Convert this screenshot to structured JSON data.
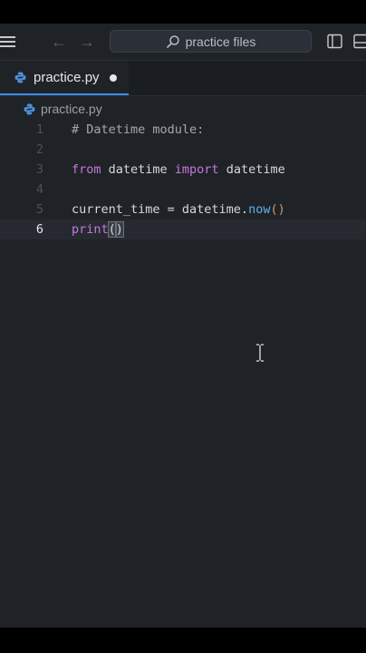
{
  "titlebar": {
    "search_placeholder": "practice files",
    "icons": [
      "menu-icon",
      "back-arrow-icon",
      "forward-arrow-icon",
      "search-icon",
      "split-editor-icon",
      "panel-layout-icon"
    ]
  },
  "nav": {
    "back_glyph": "←",
    "forward_glyph": "→"
  },
  "tab": {
    "label": "practice.py",
    "modified": true
  },
  "breadcrumb": {
    "file": "practice.py"
  },
  "editor": {
    "active_line": 6,
    "lines": [
      {
        "num": "1",
        "text": "# Datetime module:"
      },
      {
        "num": "2",
        "text": ""
      },
      {
        "num": "3",
        "text": "from datetime import datetime"
      },
      {
        "num": "4",
        "text": ""
      },
      {
        "num": "5",
        "text": "current_time = datetime.now()"
      },
      {
        "num": "6",
        "text": "print()"
      }
    ]
  },
  "tokens": {
    "l1_comment": "# Datetime module:",
    "l3_from": "from",
    "l3_mod": " datetime ",
    "l3_import": "import",
    "l3_name": " datetime",
    "l5_var": "current_time = datetime.",
    "l5_fn": "now",
    "l5_parens": "()",
    "l6_fn": "print",
    "l6_open": "(",
    "l6_close": ")"
  },
  "colors": {
    "background": "#1f2328",
    "accent": "#3b8eea",
    "keyword": "#c678dd",
    "function": "#61afef",
    "paren": "#d19a66"
  }
}
